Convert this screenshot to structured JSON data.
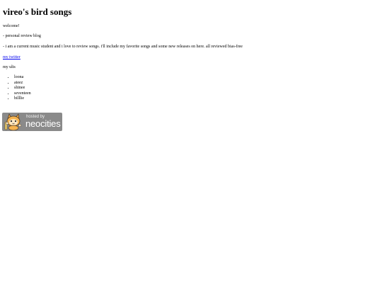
{
  "page": {
    "title": "vireo's bird songs",
    "welcome": "welcome!",
    "line1": "- personal review blog",
    "line2": "- i am a current music student and i love to review songs. i'll include my favorite songs and some new releases on here. all reviewed bias-free",
    "twitter_link": "my twitter",
    "ults_label": "my ults",
    "ults": [
      "loona",
      "ateez",
      "shinee",
      "seventeen",
      "billlie"
    ]
  },
  "badge": {
    "small_text": "hosted by",
    "big_text": "neocities",
    "icon": "neocities-cat-icon",
    "bg_color": "#8a8a8a"
  },
  "colors": {
    "link": "#0000ee",
    "text": "#000000",
    "background": "#ffffff"
  }
}
